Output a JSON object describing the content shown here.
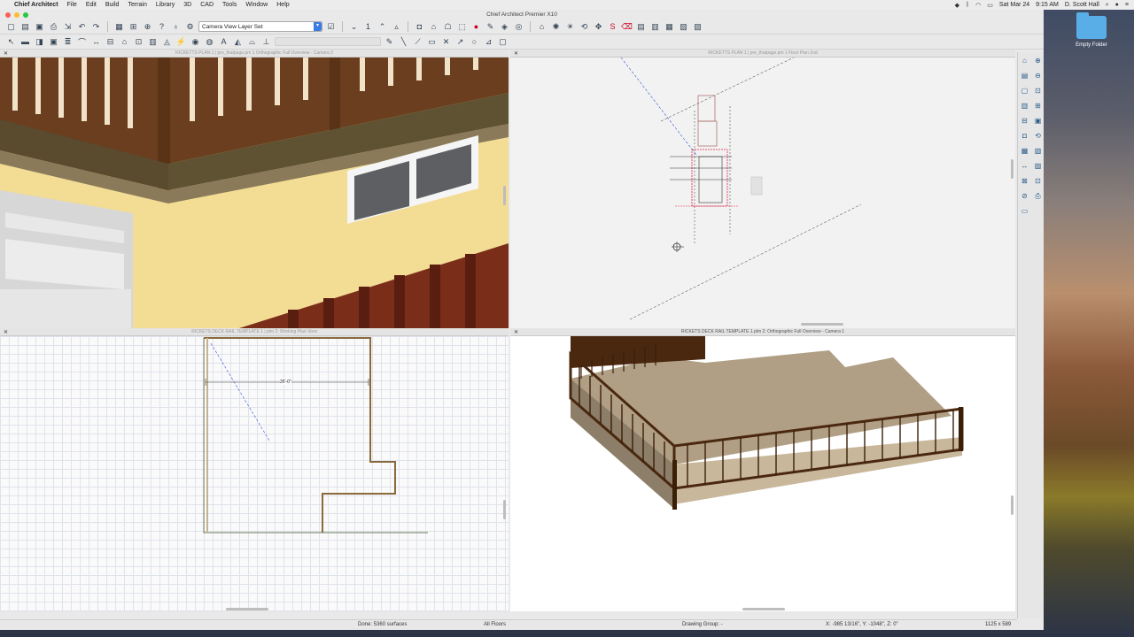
{
  "menubar": {
    "app": "Chief Architect",
    "items": [
      "File",
      "Edit",
      "Build",
      "Terrain",
      "Library",
      "3D",
      "CAD",
      "Tools",
      "Window",
      "Help"
    ],
    "date": "Sat Mar 24",
    "time": "9:15 AM",
    "user": "D. Scott Hall"
  },
  "desktop": {
    "folder_label": "Empty Folder"
  },
  "window": {
    "title": "Chief Architect Premier X10"
  },
  "toolbar": {
    "layer_set": "Camera View Layer Set"
  },
  "views": {
    "top_left": {
      "title": "RICKETTS PLAN 1 | pre_thatpage.pm 1 Orthographic Full Overview - Camera 2"
    },
    "top_right": {
      "title": "RICKETTS PLAN 1 | pre_thatpage.pm 1 Floor Plan 2nd"
    },
    "bottom_left": {
      "title": "RICKETS DECK RAIL TEMPLATE 1 | plm 2: Working Plan View",
      "dimension": "26'-0\""
    },
    "bottom_right": {
      "title": "RICKETS DECK RAIL TEMPLATE 1.plm 2: Orthographic Full Overview - Camera 1"
    }
  },
  "status": {
    "done": "Done:  5360 surfaces",
    "floors": "All Floors",
    "drawing_group": "Drawing Group: -",
    "coords": "X: -985 13/16\", Y: -1048\", Z: 0\"",
    "size": "1125 x 589"
  }
}
